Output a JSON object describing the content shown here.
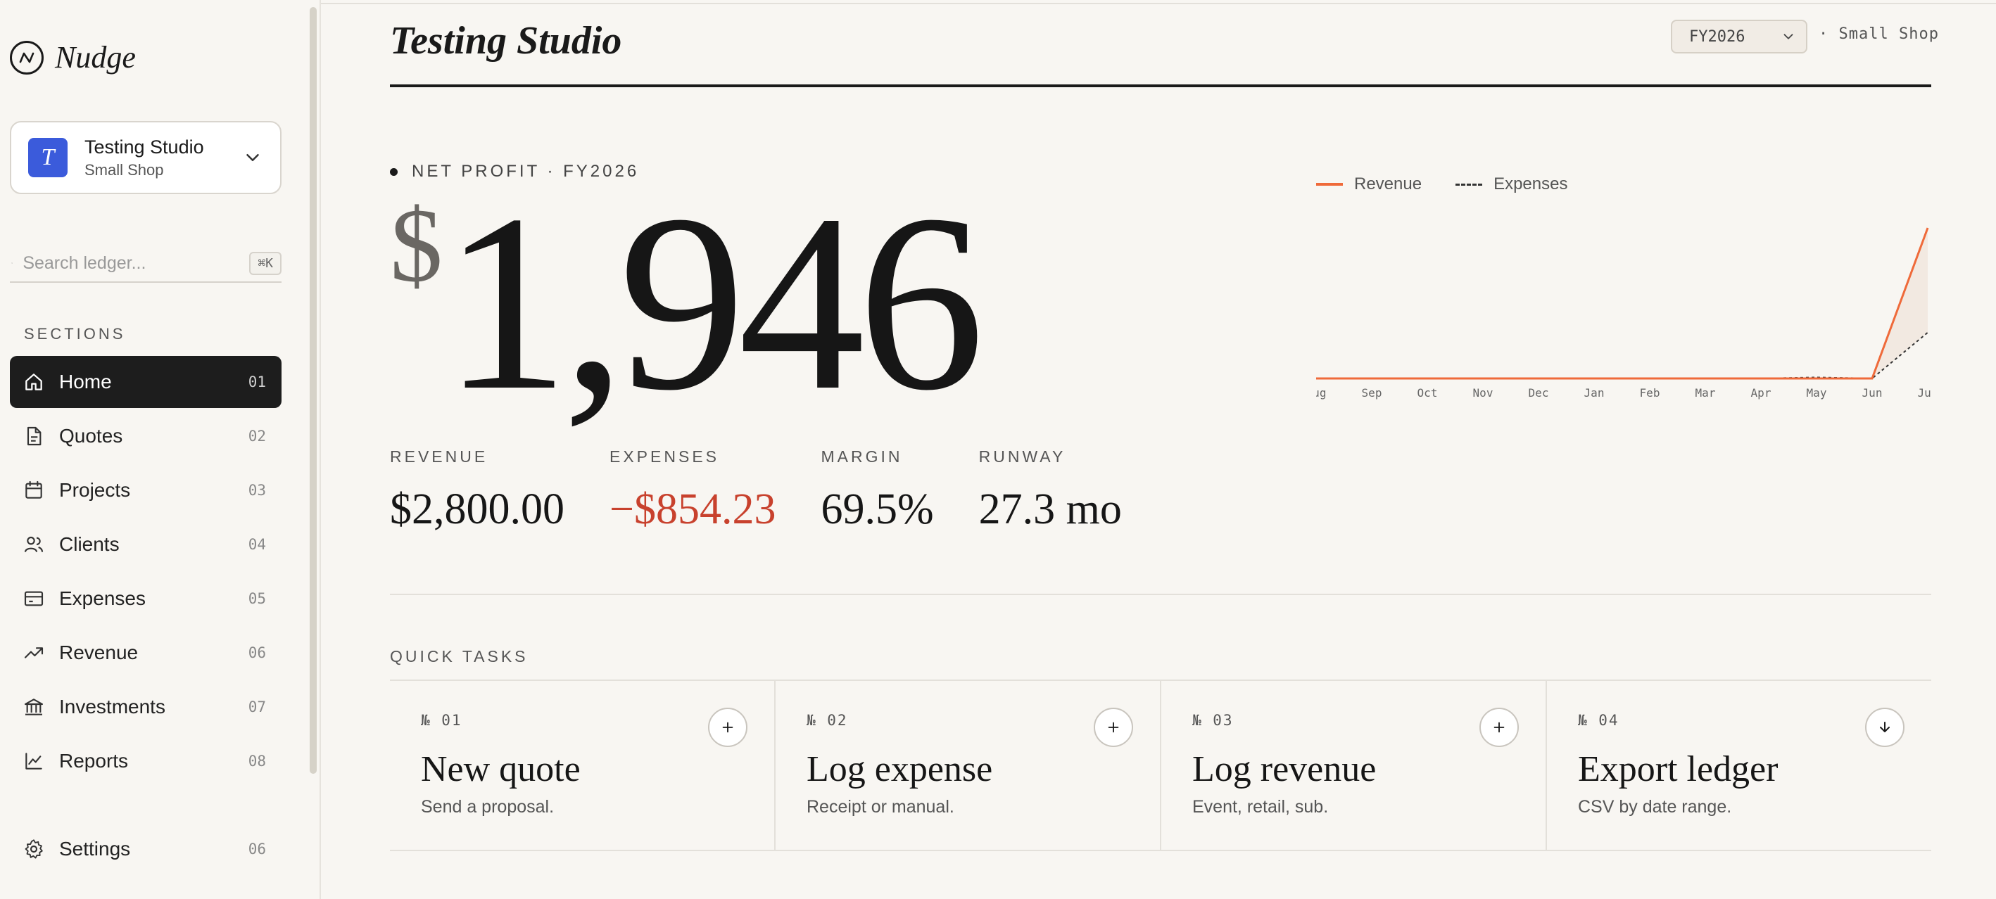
{
  "brand": {
    "name": "Nudge",
    "logo_icon": "n-logo-icon"
  },
  "workspace": {
    "initial": "T",
    "name": "Testing Studio",
    "subtitle": "Small Shop",
    "accent": "#3b5bdb"
  },
  "search": {
    "placeholder": "Search ledger...",
    "shortcut": "⌘K"
  },
  "sidebar": {
    "section_label": "SECTIONS",
    "items": [
      {
        "label": "Home",
        "num": "01",
        "icon": "home-icon"
      },
      {
        "label": "Quotes",
        "num": "02",
        "icon": "document-icon"
      },
      {
        "label": "Projects",
        "num": "03",
        "icon": "calendar-icon"
      },
      {
        "label": "Clients",
        "num": "04",
        "icon": "users-icon"
      },
      {
        "label": "Expenses",
        "num": "05",
        "icon": "card-icon"
      },
      {
        "label": "Revenue",
        "num": "06",
        "icon": "trend-up-icon"
      },
      {
        "label": "Investments",
        "num": "07",
        "icon": "bank-icon"
      },
      {
        "label": "Reports",
        "num": "08",
        "icon": "line-chart-icon"
      }
    ],
    "settings": {
      "label": "Settings",
      "num": "06",
      "icon": "gear-icon"
    }
  },
  "header": {
    "title": "Testing Studio",
    "fiscal_year": "FY2026",
    "meta": "· Small Shop"
  },
  "hero": {
    "kicker": "NET PROFIT · FY2026",
    "currency": "$",
    "value": "1,946"
  },
  "stats": [
    {
      "label": "REVENUE",
      "value": "$2,800.00",
      "negative": false
    },
    {
      "label": "EXPENSES",
      "value": "−$854.23",
      "negative": true
    },
    {
      "label": "MARGIN",
      "value": "69.5%",
      "negative": false
    },
    {
      "label": "RUNWAY",
      "value": "27.3 mo",
      "negative": false
    }
  ],
  "colors": {
    "revenue": "#ef6a3a",
    "expenses": "#333333",
    "negative": "#c8412d"
  },
  "chart_data": {
    "type": "line",
    "categories": [
      "Aug",
      "Sep",
      "Oct",
      "Nov",
      "Dec",
      "Jan",
      "Feb",
      "Mar",
      "Apr",
      "May",
      "Jun",
      "Jul"
    ],
    "series": [
      {
        "name": "Revenue",
        "values": [
          0,
          0,
          0,
          0,
          0,
          0,
          0,
          0,
          0,
          0,
          0,
          2800
        ]
      },
      {
        "name": "Expenses",
        "values": [
          0,
          0,
          0,
          0,
          0,
          0,
          0,
          0,
          0,
          20,
          0,
          854.23
        ]
      }
    ],
    "ylim": [
      0,
      2800
    ],
    "legend": "top-left",
    "grid": false
  },
  "quick_tasks": {
    "label": "QUICK TASKS",
    "items": [
      {
        "no": "№ 01",
        "title": "New quote",
        "sub": "Send a proposal.",
        "icon": "plus-icon"
      },
      {
        "no": "№ 02",
        "title": "Log expense",
        "sub": "Receipt or manual.",
        "icon": "plus-icon"
      },
      {
        "no": "№ 03",
        "title": "Log revenue",
        "sub": "Event, retail, sub.",
        "icon": "plus-icon"
      },
      {
        "no": "№ 04",
        "title": "Export ledger",
        "sub": "CSV by date range.",
        "icon": "download-icon"
      }
    ]
  }
}
